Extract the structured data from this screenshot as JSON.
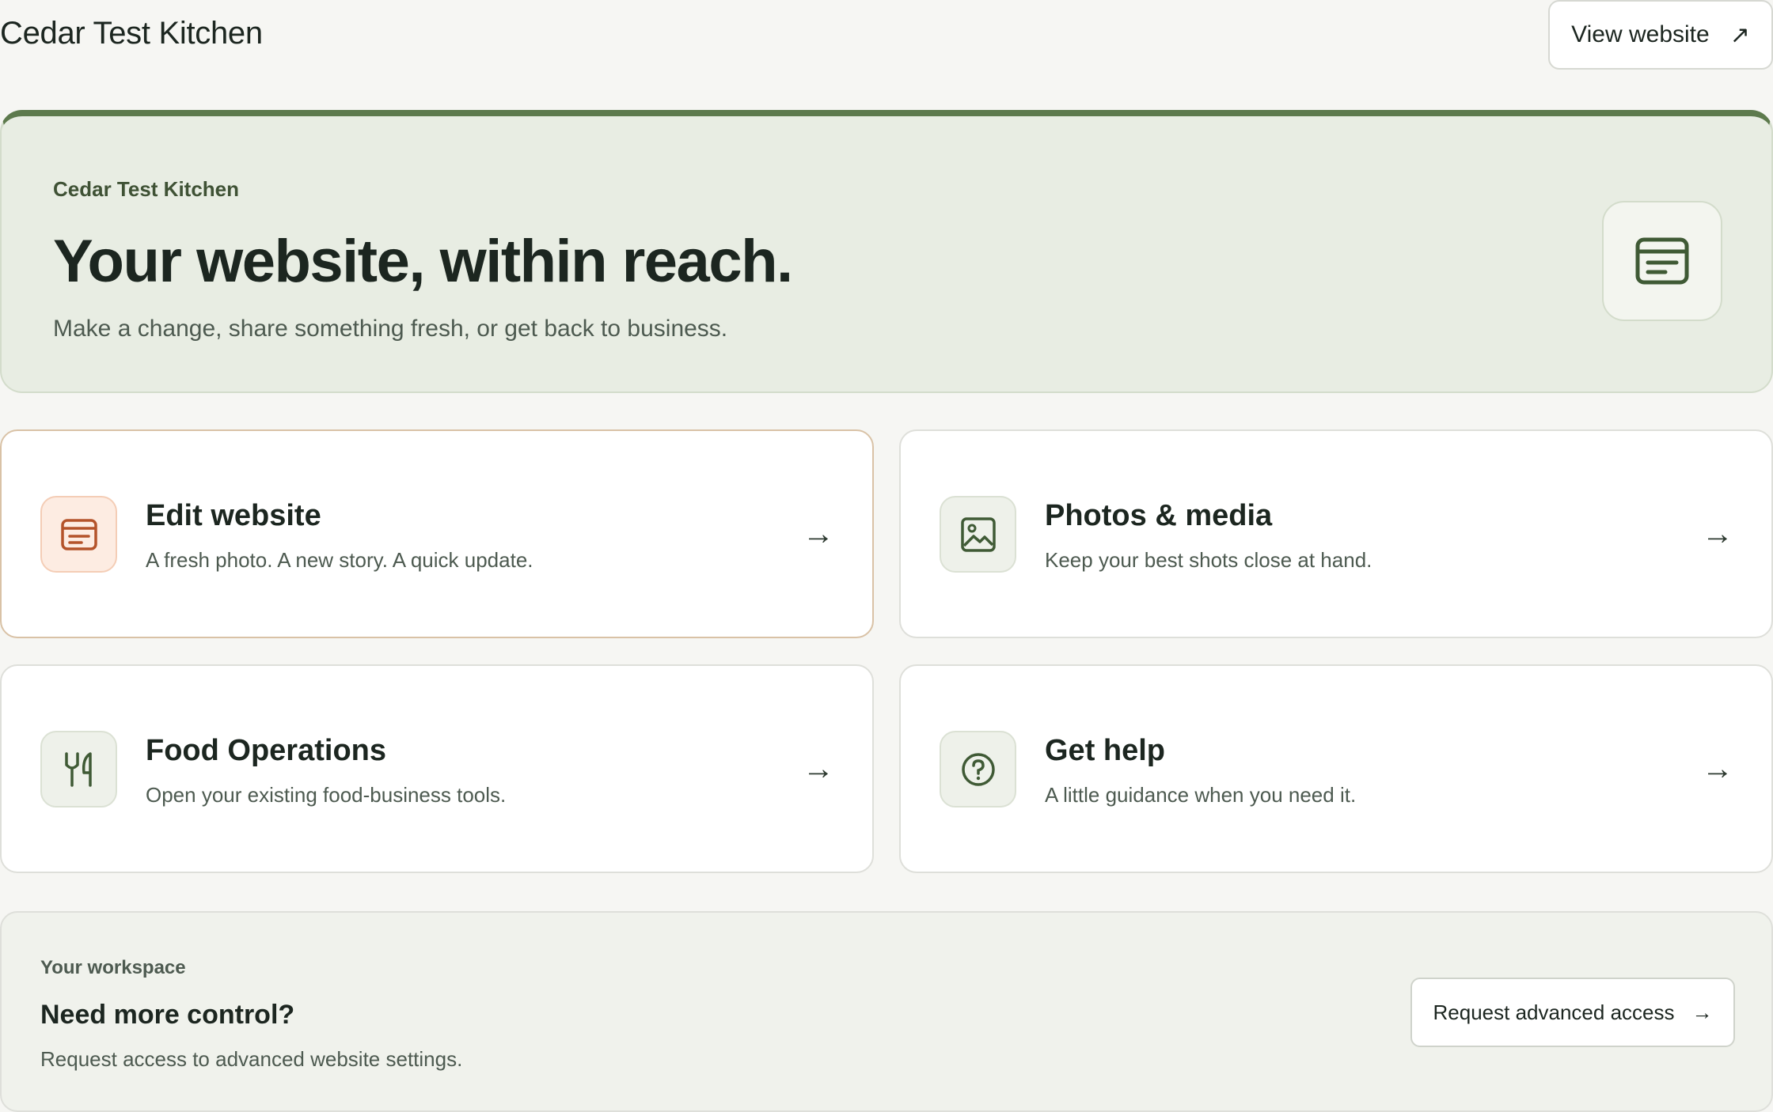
{
  "header": {
    "site_title": "Cedar Test Kitchen",
    "view_website_label": "View website",
    "view_website_arrow": "↗"
  },
  "hero": {
    "kicker": "Cedar Test Kitchen",
    "title": "Your website, within reach.",
    "subtitle": "Make a change, share something fresh, or get back to business.",
    "icon": "website-icon"
  },
  "cards": [
    {
      "title": "Edit website",
      "desc": "A fresh photo. A new story. A quick update.",
      "arrow": "→",
      "icon": "website-icon"
    },
    {
      "title": "Photos & media",
      "desc": "Keep your best shots close at hand.",
      "arrow": "→",
      "icon": "image-icon"
    },
    {
      "title": "Food Operations",
      "desc": "Open your existing food-business tools.",
      "arrow": "→",
      "icon": "utensils-icon"
    },
    {
      "title": "Get help",
      "desc": "A little guidance when you need it.",
      "arrow": "→",
      "icon": "help-icon"
    }
  ],
  "workspace": {
    "kicker": "Your workspace",
    "title": "Need more control?",
    "desc": "Request access to advanced website settings.",
    "button_label": "Request advanced access",
    "button_arrow": "→"
  },
  "colors": {
    "accent_green": "#5d7a4d",
    "accent_orange": "#c8643a",
    "hero_bg": "#e8ede3"
  }
}
